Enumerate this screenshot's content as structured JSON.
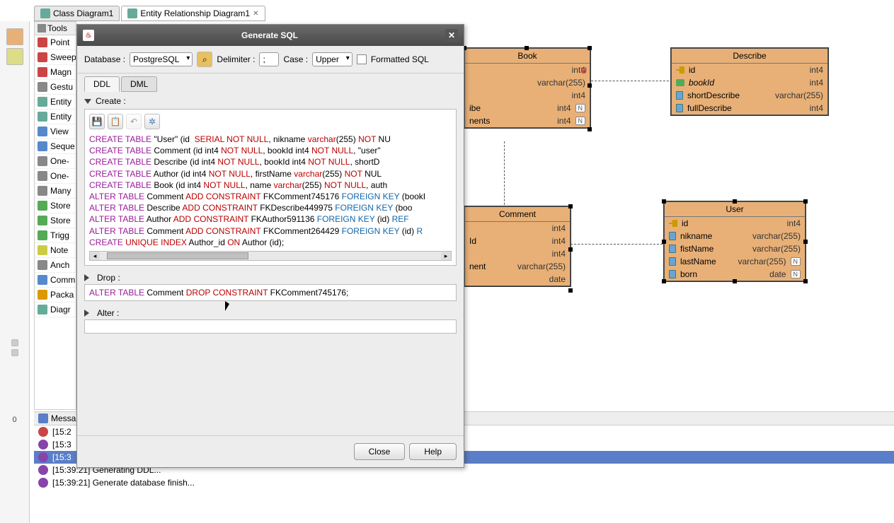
{
  "tabs": [
    {
      "label": "Class Diagram1"
    },
    {
      "label": "Entity Relationship Diagram1"
    }
  ],
  "sidebar_num": "0",
  "tools": {
    "header": "Tools",
    "items": [
      {
        "label": "Point",
        "color": "#c44"
      },
      {
        "label": "Sweep",
        "color": "#c44"
      },
      {
        "label": "Magn",
        "color": "#c44"
      },
      {
        "label": "Gestu",
        "color": "#888"
      },
      {
        "label": "Entity",
        "color": "#6a9"
      },
      {
        "label": "Entity",
        "color": "#6a9"
      },
      {
        "label": "View",
        "color": "#58c"
      },
      {
        "label": "Seque",
        "color": "#58c"
      },
      {
        "label": "One-",
        "color": "#888"
      },
      {
        "label": "One-",
        "color": "#888"
      },
      {
        "label": "Many",
        "color": "#888"
      },
      {
        "label": "Store",
        "color": "#5a5"
      },
      {
        "label": "Store",
        "color": "#5a5"
      },
      {
        "label": "Trigg",
        "color": "#5a5"
      },
      {
        "label": "Note",
        "color": "#cc4"
      },
      {
        "label": "Anch",
        "color": "#888"
      },
      {
        "label": "Comm",
        "color": "#58c"
      },
      {
        "label": "Packa",
        "color": "#d90"
      },
      {
        "label": "Diagr",
        "color": "#6a9"
      }
    ]
  },
  "dialog": {
    "title": "Generate SQL",
    "database_label": "Database :",
    "database_value": "PostgreSQL",
    "delimiter_label": "Delimiter :",
    "delimiter_value": ";",
    "case_label": "Case :",
    "case_value": "Upper",
    "formatted_label": "Formatted SQL",
    "tabs": {
      "ddl": "DDL",
      "dml": "DML"
    },
    "create_label": "Create :",
    "drop_label": "Drop :",
    "alter_label": "Alter :",
    "drop_sql_plain": "ALTER TABLE Comment DROP CONSTRAINT FKComment745176;",
    "close": "Close",
    "help": "Help"
  },
  "sql_lines": [
    [
      [
        "CREATE",
        "p"
      ],
      [
        " ",
        "b"
      ],
      [
        "TABLE",
        "p"
      ],
      [
        " \"User\" (id  ",
        "b"
      ],
      [
        "SERIAL",
        "r"
      ],
      [
        " ",
        "b"
      ],
      [
        "NOT",
        "r"
      ],
      [
        " ",
        "b"
      ],
      [
        "NULL",
        "r"
      ],
      [
        ", nikname ",
        "b"
      ],
      [
        "varchar",
        "r"
      ],
      [
        "(255) ",
        "b"
      ],
      [
        "NOT",
        "r"
      ],
      [
        " NU",
        "b"
      ]
    ],
    [
      [
        "CREATE",
        "p"
      ],
      [
        " ",
        "b"
      ],
      [
        "TABLE",
        "p"
      ],
      [
        " Comment (id int4 ",
        "b"
      ],
      [
        "NOT",
        "r"
      ],
      [
        " ",
        "b"
      ],
      [
        "NULL",
        "r"
      ],
      [
        ", bookId int4 ",
        "b"
      ],
      [
        "NOT",
        "r"
      ],
      [
        " ",
        "b"
      ],
      [
        "NULL",
        "r"
      ],
      [
        ", \"user\"",
        "b"
      ]
    ],
    [
      [
        "CREATE",
        "p"
      ],
      [
        " ",
        "b"
      ],
      [
        "TABLE",
        "p"
      ],
      [
        " Describe (id int4 ",
        "b"
      ],
      [
        "NOT",
        "r"
      ],
      [
        " ",
        "b"
      ],
      [
        "NULL",
        "r"
      ],
      [
        ", bookId int4 ",
        "b"
      ],
      [
        "NOT",
        "r"
      ],
      [
        " ",
        "b"
      ],
      [
        "NULL",
        "r"
      ],
      [
        ", shortD",
        "b"
      ]
    ],
    [
      [
        "CREATE",
        "p"
      ],
      [
        " ",
        "b"
      ],
      [
        "TABLE",
        "p"
      ],
      [
        " Author (id int4 ",
        "b"
      ],
      [
        "NOT",
        "r"
      ],
      [
        " ",
        "b"
      ],
      [
        "NULL",
        "r"
      ],
      [
        ", firstName ",
        "b"
      ],
      [
        "varchar",
        "r"
      ],
      [
        "(255) ",
        "b"
      ],
      [
        "NOT",
        "r"
      ],
      [
        " NUL",
        "b"
      ]
    ],
    [
      [
        "CREATE",
        "p"
      ],
      [
        " ",
        "b"
      ],
      [
        "TABLE",
        "p"
      ],
      [
        " Book (id int4 ",
        "b"
      ],
      [
        "NOT",
        "r"
      ],
      [
        " ",
        "b"
      ],
      [
        "NULL",
        "r"
      ],
      [
        ", name ",
        "b"
      ],
      [
        "varchar",
        "r"
      ],
      [
        "(255) ",
        "b"
      ],
      [
        "NOT",
        "r"
      ],
      [
        " ",
        "b"
      ],
      [
        "NULL",
        "r"
      ],
      [
        ", auth",
        "b"
      ]
    ],
    [
      [
        "ALTER",
        "p"
      ],
      [
        " ",
        "b"
      ],
      [
        "TABLE",
        "p"
      ],
      [
        " Comment ",
        "b"
      ],
      [
        "ADD",
        "r"
      ],
      [
        " ",
        "b"
      ],
      [
        "CONSTRAINT",
        "r"
      ],
      [
        " FKComment745176 ",
        "b"
      ],
      [
        "FOREIGN",
        "bl"
      ],
      [
        " ",
        "b"
      ],
      [
        "KEY",
        "bl"
      ],
      [
        " (bookI",
        "b"
      ]
    ],
    [
      [
        "ALTER",
        "p"
      ],
      [
        " ",
        "b"
      ],
      [
        "TABLE",
        "p"
      ],
      [
        " Describe ",
        "b"
      ],
      [
        "ADD",
        "r"
      ],
      [
        " ",
        "b"
      ],
      [
        "CONSTRAINT",
        "r"
      ],
      [
        " FKDescribe449975 ",
        "b"
      ],
      [
        "FOREIGN",
        "bl"
      ],
      [
        " ",
        "b"
      ],
      [
        "KEY",
        "bl"
      ],
      [
        " (boo",
        "b"
      ]
    ],
    [
      [
        "ALTER",
        "p"
      ],
      [
        " ",
        "b"
      ],
      [
        "TABLE",
        "p"
      ],
      [
        " Author ",
        "b"
      ],
      [
        "ADD",
        "r"
      ],
      [
        " ",
        "b"
      ],
      [
        "CONSTRAINT",
        "r"
      ],
      [
        " FKAuthor591136 ",
        "b"
      ],
      [
        "FOREIGN",
        "bl"
      ],
      [
        " ",
        "b"
      ],
      [
        "KEY",
        "bl"
      ],
      [
        " (id) ",
        "b"
      ],
      [
        "REF",
        "bl"
      ]
    ],
    [
      [
        "ALTER",
        "p"
      ],
      [
        " ",
        "b"
      ],
      [
        "TABLE",
        "p"
      ],
      [
        " Comment ",
        "b"
      ],
      [
        "ADD",
        "r"
      ],
      [
        " ",
        "b"
      ],
      [
        "CONSTRAINT",
        "r"
      ],
      [
        " FKComment264429 ",
        "b"
      ],
      [
        "FOREIGN",
        "bl"
      ],
      [
        " ",
        "b"
      ],
      [
        "KEY",
        "bl"
      ],
      [
        " (id) ",
        "b"
      ],
      [
        "R",
        "bl"
      ]
    ],
    [
      [
        "CREATE",
        "p"
      ],
      [
        " ",
        "b"
      ],
      [
        "UNIQUE",
        "r"
      ],
      [
        " ",
        "b"
      ],
      [
        "INDEX",
        "r"
      ],
      [
        " Author_id ",
        "b"
      ],
      [
        "ON",
        "r"
      ],
      [
        " Author (id);",
        "b"
      ]
    ]
  ],
  "drop_tokens": [
    [
      "ALTER",
      "p"
    ],
    [
      " ",
      "b"
    ],
    [
      "TABLE",
      "p"
    ],
    [
      " Comment ",
      "b"
    ],
    [
      "DROP",
      "r"
    ],
    [
      " ",
      "b"
    ],
    [
      "CONSTRAINT",
      "r"
    ],
    [
      " FKComment745176;",
      "b"
    ]
  ],
  "entities": {
    "book": {
      "title": "Book",
      "rows": [
        {
          "name": "",
          "type": "int4",
          "badge": ""
        },
        {
          "name": "",
          "type": "varchar(255)",
          "badge": ""
        },
        {
          "name": "",
          "type": "int4",
          "badge": ""
        },
        {
          "name": "ibe",
          "type": "int4",
          "badge": "N"
        },
        {
          "name": "nents",
          "type": "int4",
          "badge": "N"
        }
      ]
    },
    "describe": {
      "title": "Describe",
      "rows": [
        {
          "icon": "key",
          "name": "id",
          "type": "int4"
        },
        {
          "icon": "fk",
          "name": "bookId",
          "type": "int4",
          "italic": true
        },
        {
          "icon": "col",
          "name": "shortDescribe",
          "type": "varchar(255)"
        },
        {
          "icon": "col",
          "name": "fullDescribe",
          "type": "int4"
        }
      ]
    },
    "comment": {
      "title": "Comment",
      "rows": [
        {
          "name": "",
          "type": "int4"
        },
        {
          "name": "Id",
          "type": "int4"
        },
        {
          "name": "",
          "type": "int4"
        },
        {
          "name": "nent",
          "type": "varchar(255)"
        },
        {
          "name": "",
          "type": "date"
        }
      ]
    },
    "user": {
      "title": "User",
      "rows": [
        {
          "icon": "key",
          "name": "id",
          "type": "int4"
        },
        {
          "icon": "col",
          "name": "nikname",
          "type": "varchar(255)"
        },
        {
          "icon": "col",
          "name": "fistName",
          "type": "varchar(255)"
        },
        {
          "icon": "col",
          "name": "lastName",
          "type": "varchar(255)",
          "badge": "N"
        },
        {
          "icon": "col",
          "name": "born",
          "type": "date",
          "badge": "N"
        }
      ]
    }
  },
  "messages": {
    "header": "Messa",
    "rows": [
      {
        "type": "err",
        "text": "[15:2"
      },
      {
        "type": "info",
        "text": "[15:3"
      },
      {
        "type": "info",
        "text": "[15:3",
        "selected": true
      },
      {
        "type": "info",
        "text": "[15:39:21] Generating DDL..."
      },
      {
        "type": "info",
        "text": "[15:39:21] Generate database finish..."
      }
    ]
  }
}
